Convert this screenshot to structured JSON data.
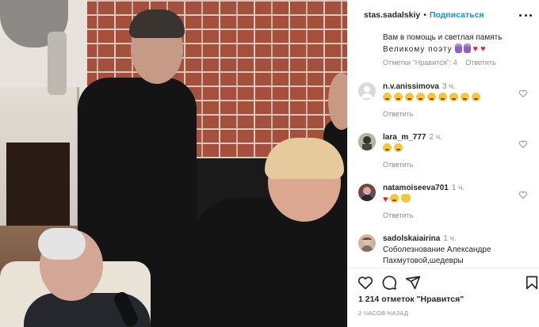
{
  "post": {
    "username": "stas.sadalskiy",
    "separator": "•",
    "follow_label": "Подписаться"
  },
  "first_comment": {
    "line1": "Вам в помощь и светлая память",
    "line2": "Великому поэту",
    "likes_label": "Отметки \"Нравится\": 4",
    "reply_label": "Ответить"
  },
  "comments": [
    {
      "username": "n.v.anissimova",
      "time": "3 ч.",
      "reply_label": "Ответить",
      "emojis": "sad x9"
    },
    {
      "username": "lara_m_777",
      "time": "2 ч.",
      "reply_label": "Ответить",
      "emojis": "sad x2"
    },
    {
      "username": "natamoiseeva701",
      "time": "1 ч.",
      "reply_label": "Ответить",
      "emojis": "heart sad hands"
    },
    {
      "username": "sadolskaiairina",
      "time": "1 ч.",
      "text_line1": "Соболезнование Александре",
      "text_line2": "Пахмутовой,шедевры"
    }
  ],
  "footer": {
    "likes_text": "1 214 отметок \"Нравится\"",
    "date_text": "2 часов назад"
  },
  "colors": {
    "accent": "#0095f6",
    "text": "#262626",
    "muted": "#8e8e8e",
    "heart_emoji": "#e02a3b"
  },
  "icons": [
    "more-options-icon",
    "like-heart-icon",
    "comment-icon",
    "share-icon",
    "bookmark-icon"
  ]
}
